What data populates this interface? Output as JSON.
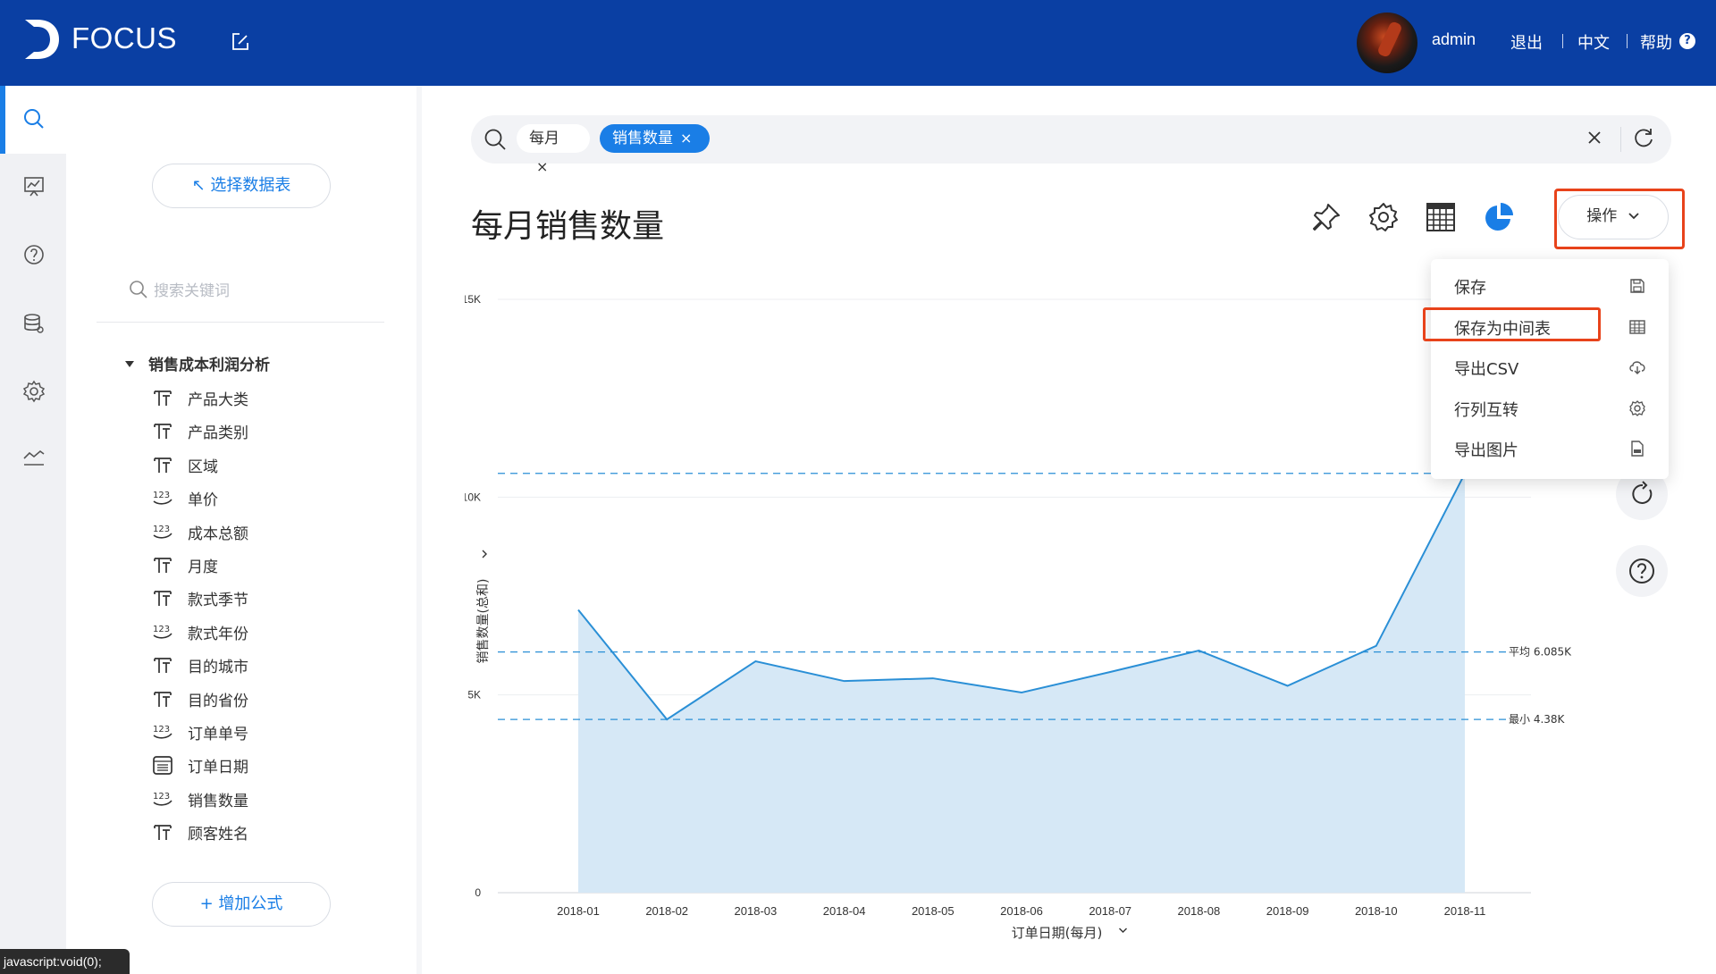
{
  "header": {
    "brand": "FOCUS",
    "user": "admin",
    "logout": "退出",
    "language": "中文",
    "help": "帮助",
    "help_badge": "?"
  },
  "panel": {
    "select_table_label": "选择数据表",
    "select_table_arrow": "↖",
    "search_placeholder": "搜索关键词",
    "table_name": "销售成本利润分析",
    "fields": [
      {
        "label": "产品大类",
        "type": "text"
      },
      {
        "label": "产品类别",
        "type": "text"
      },
      {
        "label": "区域",
        "type": "text"
      },
      {
        "label": "单价",
        "type": "number"
      },
      {
        "label": "成本总额",
        "type": "number"
      },
      {
        "label": "月度",
        "type": "text"
      },
      {
        "label": "款式季节",
        "type": "text"
      },
      {
        "label": "款式年份",
        "type": "number"
      },
      {
        "label": "目的城市",
        "type": "text"
      },
      {
        "label": "目的省份",
        "type": "text"
      },
      {
        "label": "订单单号",
        "type": "number"
      },
      {
        "label": "订单日期",
        "type": "date"
      },
      {
        "label": "销售数量",
        "type": "number"
      },
      {
        "label": "顾客姓名",
        "type": "text"
      }
    ],
    "add_formula_label": "增加公式",
    "add_formula_plus": "+"
  },
  "search": {
    "tokens": [
      "每月",
      "销售数量"
    ],
    "token_close": "×"
  },
  "title": "每月销售数量",
  "ops_button": "操作",
  "menu": [
    {
      "label": "保存",
      "icon": "save-icon"
    },
    {
      "label": "保存为中间表",
      "icon": "table-icon"
    },
    {
      "label": "导出CSV",
      "icon": "cloud-download-icon"
    },
    {
      "label": "行列互转",
      "icon": "gear-icon"
    },
    {
      "label": "导出图片",
      "icon": "image-file-icon"
    }
  ],
  "colors": {
    "header": "#0a3fa3",
    "accent": "#1a7ee6",
    "highlight": "#e8431b",
    "line": "#2a8fd6",
    "area": "#d6e8f6"
  },
  "status_tip": "javascript:void(0);",
  "chart_data": {
    "type": "area",
    "x": [
      "2018-01",
      "2018-02",
      "2018-03",
      "2018-04",
      "2018-05",
      "2018-06",
      "2018-07",
      "2018-08",
      "2018-09",
      "2018-10",
      "2018-11"
    ],
    "series": [
      {
        "values": [
          7150,
          4380,
          5850,
          5350,
          5420,
          5060,
          5580,
          6120,
          5230,
          6240,
          10600
        ]
      }
    ],
    "xlabel": "订单日期(每月)",
    "ylabel": "销售数量(总和)",
    "ylim": [
      0,
      15000
    ],
    "yticks": [
      {
        "v": 0,
        "label": "0"
      },
      {
        "v": 5000,
        "label": "5K"
      },
      {
        "v": 10000,
        "label": "10K"
      },
      {
        "v": 15000,
        "label": "15K"
      }
    ],
    "reference_lines": [
      {
        "label": "平均 6.085K",
        "value": 6085
      },
      {
        "label": "最小 4.38K",
        "value": 4380
      },
      {
        "label": "",
        "value": 10600
      }
    ],
    "grid": true
  }
}
